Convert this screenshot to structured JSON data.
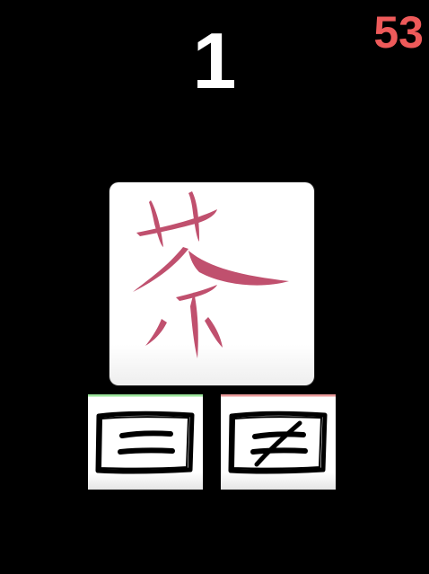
{
  "hud": {
    "score": "1",
    "timer": "53"
  },
  "card": {
    "character": "茶",
    "character_color": "#c0506e"
  },
  "answers": {
    "equal_symbol": "=",
    "not_equal_symbol": "≠"
  },
  "colors": {
    "background": "#000000",
    "score": "#ffffff",
    "timer": "#ee5a5a",
    "equal_accent": "#9be39b",
    "not_equal_accent": "#e99a9a"
  }
}
